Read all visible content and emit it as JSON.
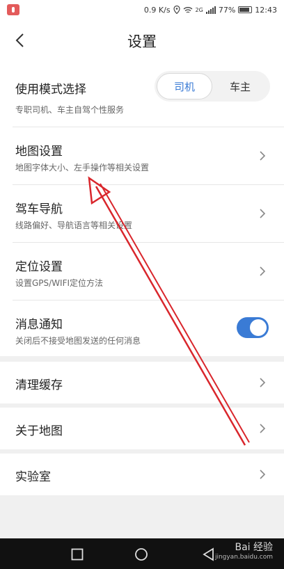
{
  "status_bar": {
    "speed": "0.9 K/s",
    "network": "2G",
    "battery": "77%",
    "time": "12:43"
  },
  "header": {
    "title": "设置"
  },
  "mode": {
    "label": "使用模式选择",
    "sub": "专职司机、车主自驾个性服务",
    "options": [
      "司机",
      "车主"
    ],
    "selected": "司机"
  },
  "items": [
    {
      "label": "地图设置",
      "sub": "地图字体大小、左手操作等相关设置"
    },
    {
      "label": "驾车导航",
      "sub": "线路偏好、导航语言等相关设置"
    },
    {
      "label": "定位设置",
      "sub": "设置GPS/WIFI定位方法"
    },
    {
      "label": "消息通知",
      "sub": "关闭后不接受地图发送的任何消息",
      "toggle_on": true
    }
  ],
  "sections": {
    "clear_cache": "清理缓存",
    "about": "关于地图",
    "lab": "实验室"
  },
  "watermark": {
    "brand": "Bai 经验",
    "url": "jingyan.baidu.com"
  },
  "colors": {
    "accent": "#3a7bd5",
    "annotation": "#d9262c"
  }
}
